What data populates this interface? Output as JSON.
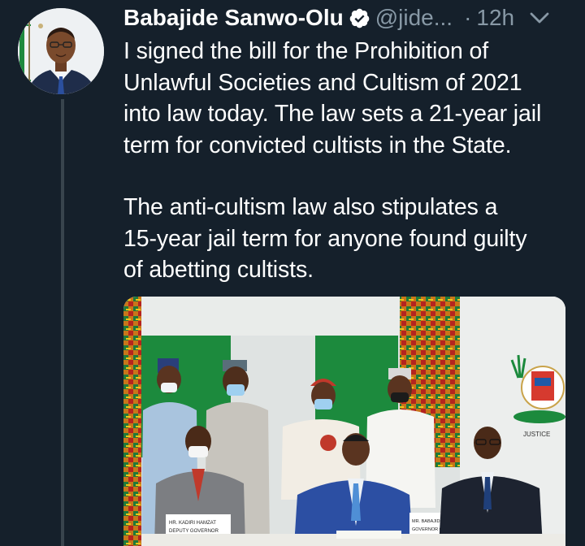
{
  "author": {
    "name": "Babajide Sanwo-Olu",
    "handle": "@jide...",
    "verified": true
  },
  "meta": {
    "separator": "·",
    "time": "12h"
  },
  "tweet": {
    "paragraph_1": "I signed the bill for the Prohibition of\nUnlawful Societies and Cultism of 2021\ninto law today. The law sets a  21-year jail\nterm for convicted cultists in the State.",
    "paragraph_2": "The anti-cultism law also stipulates a\n15-year jail term for anyone found guilty\nof abetting cultists."
  },
  "photo": {
    "name_plate_left_1": "HR. KADIRI HAMZAT",
    "name_plate_left_2": "DEPUTY GOVERNOR",
    "name_plate_center_1": "MR. BABAJIDE SANWO-OLU",
    "name_plate_center_2": "GOVERNOR OF LAGOS",
    "crest_text": "JUSTICE"
  },
  "icons": {
    "verified": "verified-badge-icon",
    "caret": "chevron-down-icon"
  },
  "colors": {
    "background": "#15202b",
    "text": "#ffffff",
    "muted": "#8899a6",
    "thread_line": "#38444d"
  }
}
